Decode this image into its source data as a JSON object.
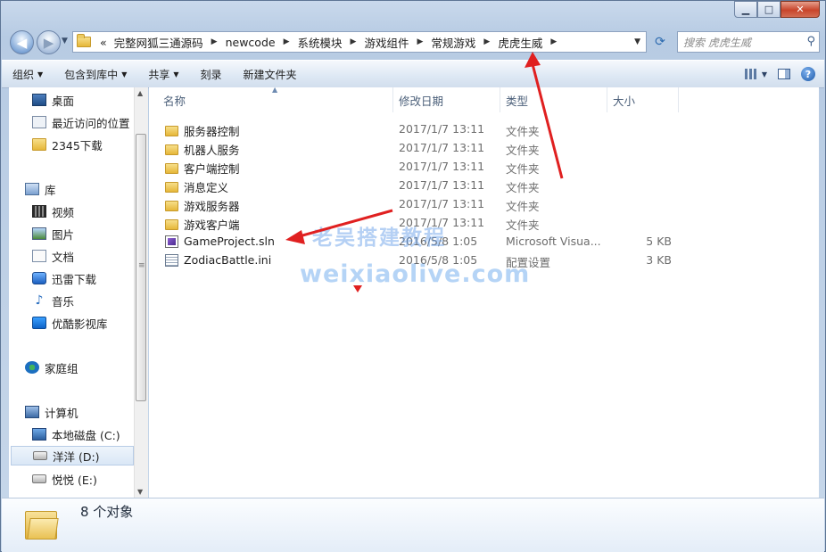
{
  "window": {
    "caption_buttons": {
      "minimize": "▁",
      "maximize": "□",
      "close": "✕"
    }
  },
  "address": {
    "overflow": "«",
    "crumbs": [
      "完整网狐三通源码",
      "newcode",
      "系统模块",
      "游戏组件",
      "常规游戏",
      "虎虎生威"
    ],
    "search_placeholder": "搜索 虎虎生威"
  },
  "toolbar": {
    "organize": "组织",
    "include_library": "包含到库中",
    "share": "共享",
    "burn": "刻录",
    "new_folder": "新建文件夹"
  },
  "sidebar": {
    "items": [
      {
        "label": "桌面",
        "icon": "desktop-icon"
      },
      {
        "label": "最近访问的位置",
        "icon": "recent-places-icon"
      },
      {
        "label": "2345下载",
        "icon": "folder-icon"
      },
      {
        "label": "库",
        "icon": "library-icon"
      },
      {
        "label": "视频",
        "icon": "video-library-icon"
      },
      {
        "label": "图片",
        "icon": "pictures-library-icon"
      },
      {
        "label": "文档",
        "icon": "documents-library-icon"
      },
      {
        "label": "迅雷下载",
        "icon": "thunder-download-icon"
      },
      {
        "label": "音乐",
        "icon": "music-library-icon"
      },
      {
        "label": "优酷影视库",
        "icon": "youku-library-icon"
      },
      {
        "label": "家庭组",
        "icon": "homegroup-icon"
      },
      {
        "label": "计算机",
        "icon": "computer-icon"
      },
      {
        "label": "本地磁盘 (C:)",
        "icon": "system-drive-icon"
      },
      {
        "label": "洋洋 (D:)",
        "icon": "drive-icon"
      },
      {
        "label": "悦悦 (E:)",
        "icon": "drive-icon"
      }
    ]
  },
  "columns": {
    "name": "名称",
    "date": "修改日期",
    "type": "类型",
    "size": "大小"
  },
  "files": [
    {
      "name": "服务器控制",
      "date": "2017/1/7 13:11",
      "type": "文件夹",
      "size": "",
      "kind": "folder"
    },
    {
      "name": "机器人服务",
      "date": "2017/1/7 13:11",
      "type": "文件夹",
      "size": "",
      "kind": "folder"
    },
    {
      "name": "客户端控制",
      "date": "2017/1/7 13:11",
      "type": "文件夹",
      "size": "",
      "kind": "folder"
    },
    {
      "name": "消息定义",
      "date": "2017/1/7 13:11",
      "type": "文件夹",
      "size": "",
      "kind": "folder"
    },
    {
      "name": "游戏服务器",
      "date": "2017/1/7 13:11",
      "type": "文件夹",
      "size": "",
      "kind": "folder"
    },
    {
      "name": "游戏客户端",
      "date": "2017/1/7 13:11",
      "type": "文件夹",
      "size": "",
      "kind": "folder"
    },
    {
      "name": "GameProject.sln",
      "date": "2016/5/8 1:05",
      "type": "Microsoft Visua...",
      "size": "5 KB",
      "kind": "sln"
    },
    {
      "name": "ZodiacBattle.ini",
      "date": "2016/5/8 1:05",
      "type": "配置设置",
      "size": "3 KB",
      "kind": "ini"
    }
  ],
  "status": {
    "count": "8 个对象"
  },
  "watermark": {
    "line1": "老吴搭建教程",
    "line2": "weixiaolive.com"
  },
  "colors": {
    "annotation_arrow": "#e02020",
    "selection": "#dae7f6",
    "link_blue": "#2d6bb0"
  }
}
